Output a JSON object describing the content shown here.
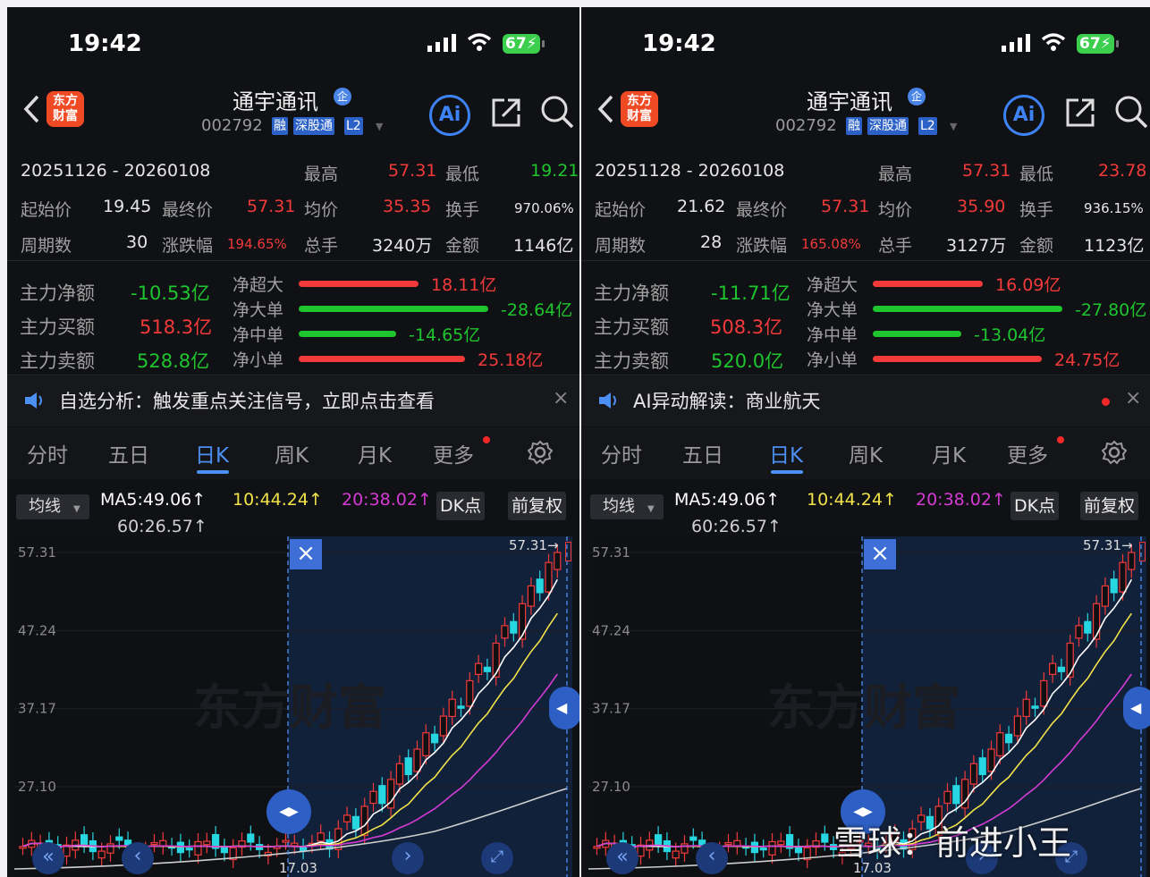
{
  "panels": [
    {
      "status": {
        "time": "19:42",
        "battery": "67"
      },
      "header": {
        "logo": "东方\n财富",
        "title": "通宇通讯",
        "qi_badge": "企",
        "code": "002792",
        "tags": [
          "融",
          "深股通",
          "L2"
        ]
      },
      "summary": {
        "range": "20251126  -  20260108",
        "high_label": "最高",
        "high": "57.31",
        "low_label": "最低",
        "low": "19.21",
        "start_label": "起始价",
        "start": "19.45",
        "end_label": "最终价",
        "end": "57.31",
        "avg_label": "均价",
        "avg": "35.35",
        "turnover_label": "换手",
        "turnover": "970.06%",
        "periods_label": "周期数",
        "periods": "30",
        "change_label": "涨跌幅",
        "change": "194.65%",
        "volume_label": "总手",
        "volume": "3240万",
        "amount_label": "金额",
        "amount": "1146亿"
      },
      "flow": {
        "net_label": "主力净额",
        "net": "-10.53亿",
        "buy_label": "主力买额",
        "buy": "518.3亿",
        "sell_label": "主力卖额",
        "sell": "528.8亿",
        "bars": [
          {
            "label": "净超大",
            "value": "18.11亿",
            "ratio": 0.632,
            "color": "#f23a3a"
          },
          {
            "label": "净大单",
            "value": "-28.64亿",
            "ratio": 1.0,
            "color": "#1ec52e"
          },
          {
            "label": "净中单",
            "value": "-14.65亿",
            "ratio": 0.512,
            "color": "#1ec52e"
          },
          {
            "label": "净小单",
            "value": "25.18亿",
            "ratio": 0.879,
            "color": "#f23a3a"
          }
        ]
      },
      "news": {
        "text": "自选分析：触发重点关注信号，立即点击查看",
        "close": "×"
      },
      "tabs": [
        "分时",
        "五日",
        "日K",
        "周K",
        "月K",
        "更多"
      ],
      "ma": {
        "select": "均线",
        "ma5": "MA5:49.06↑",
        "ma10": "10:44.24↑",
        "ma20": "20:38.02↑",
        "ma60": "60:26.57↑",
        "dk": "DK点",
        "fq": "前复权"
      },
      "chart": {
        "y_labels": [
          "57.31",
          "47.24",
          "37.17",
          "27.10"
        ],
        "last_price": "57.31→",
        "low_price": "17.03",
        "close_icon": "×",
        "watermark": "东方财富"
      }
    },
    {
      "status": {
        "time": "19:42",
        "battery": "67"
      },
      "header": {
        "logo": "东方\n财富",
        "title": "通宇通讯",
        "qi_badge": "企",
        "code": "002792",
        "tags": [
          "融",
          "深股通",
          "L2"
        ]
      },
      "summary": {
        "range": "20251128  -  20260108",
        "high_label": "最高",
        "high": "57.31",
        "low_label": "最低",
        "low": "23.78",
        "start_label": "起始价",
        "start": "21.62",
        "end_label": "最终价",
        "end": "57.31",
        "avg_label": "均价",
        "avg": "35.90",
        "turnover_label": "换手",
        "turnover": "936.15%",
        "periods_label": "周期数",
        "periods": "28",
        "change_label": "涨跌幅",
        "change": "165.08%",
        "volume_label": "总手",
        "volume": "3127万",
        "amount_label": "金额",
        "amount": "1123亿"
      },
      "flow": {
        "net_label": "主力净额",
        "net": "-11.71亿",
        "buy_label": "主力买额",
        "buy": "508.3亿",
        "sell_label": "主力卖额",
        "sell": "520.0亿",
        "bars": [
          {
            "label": "净超大",
            "value": "16.09亿",
            "ratio": 0.579,
            "color": "#f23a3a"
          },
          {
            "label": "净大单",
            "value": "-27.80亿",
            "ratio": 1.0,
            "color": "#1ec52e"
          },
          {
            "label": "净中单",
            "value": "-13.04亿",
            "ratio": 0.469,
            "color": "#1ec52e"
          },
          {
            "label": "净小单",
            "value": "24.75亿",
            "ratio": 0.89,
            "color": "#f23a3a"
          }
        ]
      },
      "news": {
        "text": "AI异动解读：商业航天",
        "close": "×"
      },
      "tabs": [
        "分时",
        "五日",
        "日K",
        "周K",
        "月K",
        "更多"
      ],
      "ma": {
        "select": "均线",
        "ma5": "MA5:49.06↑",
        "ma10": "10:44.24↑",
        "ma20": "20:38.02↑",
        "ma60": "60:26.57↑",
        "dk": "DK点",
        "fq": "前复权"
      },
      "chart": {
        "y_labels": [
          "57.31",
          "47.24",
          "37.17",
          "27.10"
        ],
        "last_price": "57.31→",
        "low_price": "17.03",
        "close_icon": "×",
        "watermark": "东方财富"
      }
    }
  ],
  "overlay_watermark": "雪球：前进小王",
  "colors": {
    "up": "#f23a3a",
    "down": "#1ec52e",
    "accent": "#4c8ff2",
    "cyan": "#26d6e0",
    "ma5": "#ffffff",
    "ma10": "#f2e34a",
    "ma20": "#d43ad4",
    "ma60": "#cfcfcf"
  }
}
